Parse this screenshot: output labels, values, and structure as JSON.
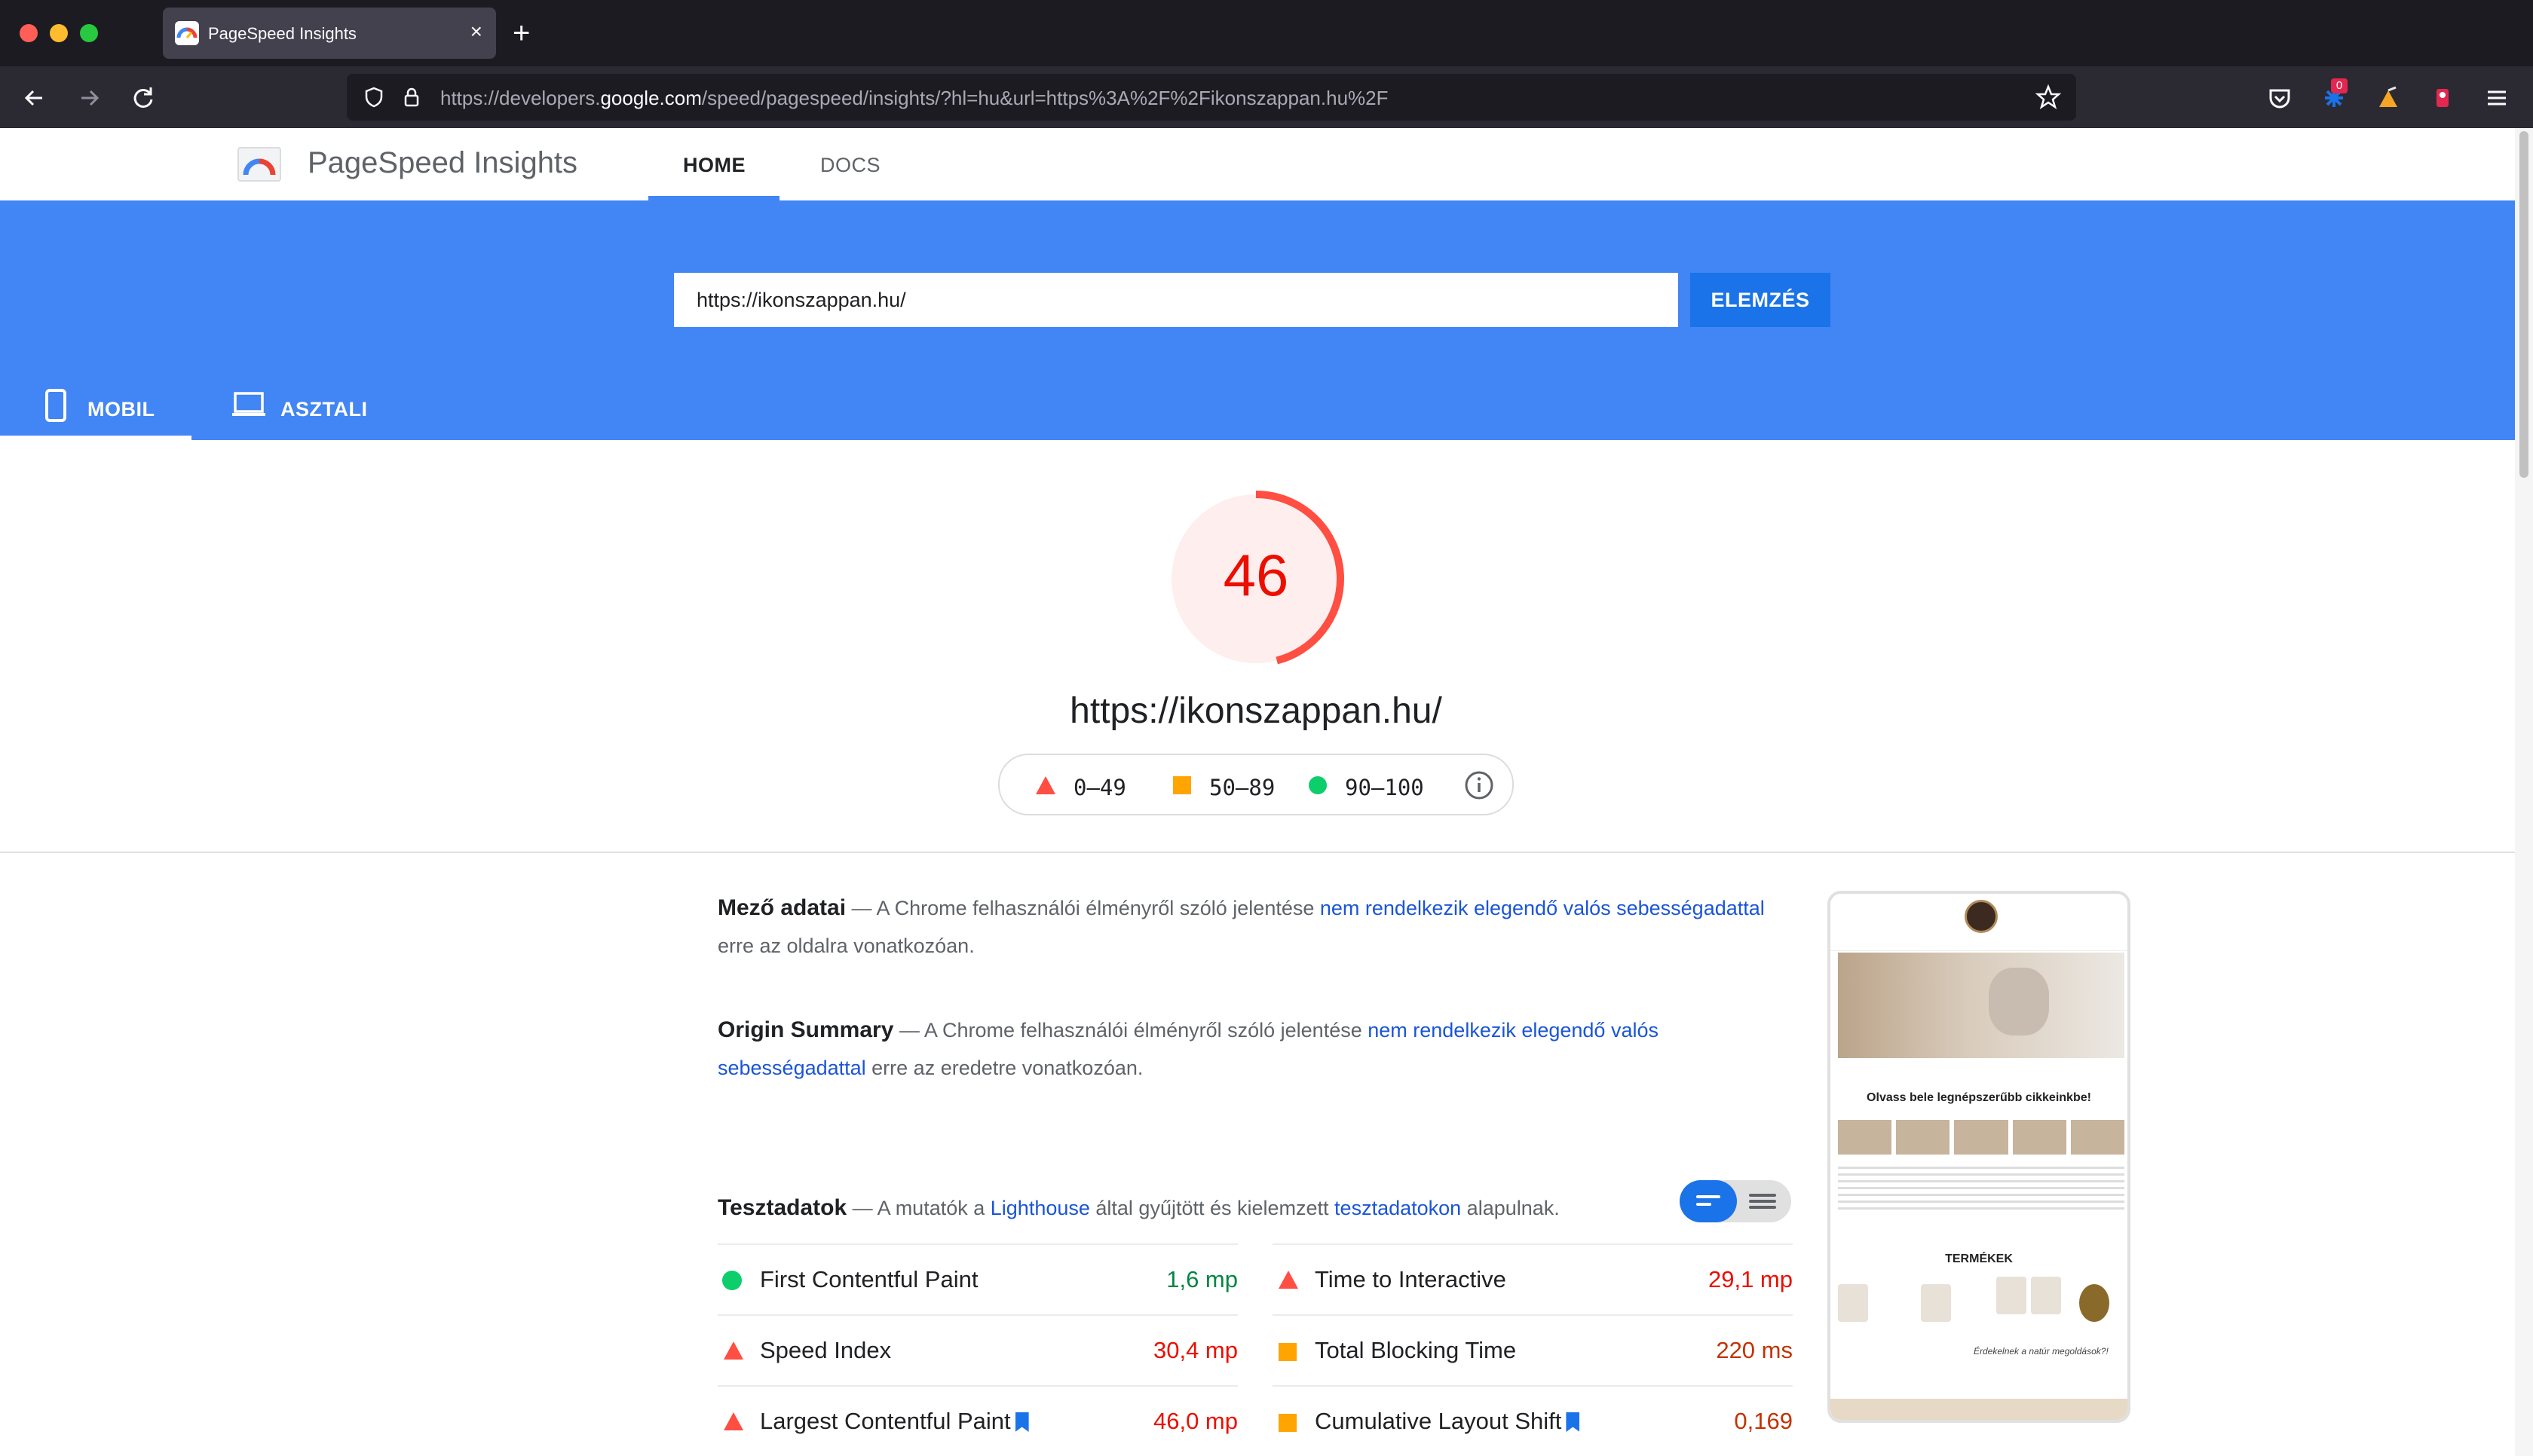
{
  "browser": {
    "tab_title": "PageSpeed Insights",
    "tab_close": "×",
    "new_tab": "+",
    "url_prefix": "https://developers.",
    "url_host": "google.com",
    "url_suffix": "/speed/pagespeed/insights/?hl=hu&url=https%3A%2F%2Fikonszappan.hu%2F",
    "extension_badge": "0",
    "icons": [
      "back-arrow-icon",
      "forward-arrow-icon",
      "reload-icon",
      "shield-icon",
      "lock-icon",
      "star-icon",
      "pocket-icon",
      "extension-icon",
      "profile-icon",
      "menu-icon"
    ]
  },
  "header": {
    "brand": "PageSpeed Insights",
    "nav_home": "HOME",
    "nav_docs": "DOCS"
  },
  "hero": {
    "url_value": "https://ikonszappan.hu/",
    "analyze_label": "ELEMZÉS",
    "tab_mobile": "MOBIL",
    "tab_desktop": "ASZTALI"
  },
  "score": {
    "value": 46,
    "display": "46",
    "url": "https://ikonszappan.hu/",
    "legend_poor": "0–49",
    "legend_avg": "50–89",
    "legend_good": "90–100",
    "color_poor": "#ff4e42",
    "color_avg": "#ffa400",
    "color_good": "#0cce6b"
  },
  "field": {
    "head": "Mező adatai",
    "text_a": " — A Chrome felhasználói élményről szóló jelentése ",
    "link": "nem rendelkezik elegendő valós sebességadattal",
    "text_b": " erre az oldalra vonatkozóan."
  },
  "origin": {
    "head": "Origin Summary",
    "text_a": " — A Chrome felhasználói élményről szóló jelentése ",
    "link": "nem rendelkezik elegendő valós sebességadattal",
    "text_b": " erre az eredetre vonatkozóan."
  },
  "lab": {
    "head": "Tesztadatok",
    "text_a": " — A mutatók a ",
    "link1": "Lighthouse",
    "text_b": " által gyűjtött és kielemzett ",
    "link2": "tesztadatokon",
    "text_c": " alapulnak."
  },
  "metrics_left": [
    {
      "name": "First Contentful Paint",
      "value": "1,6 mp",
      "rating": "good"
    },
    {
      "name": "Speed Index",
      "value": "30,4 mp",
      "rating": "poor"
    },
    {
      "name": "Largest Contentful Paint",
      "value": "46,0 mp",
      "rating": "poor"
    }
  ],
  "metrics_right": [
    {
      "name": "Time to Interactive",
      "value": "29,1 mp",
      "rating": "poor"
    },
    {
      "name": "Total Blocking Time",
      "value": "220 ms",
      "rating": "avg"
    },
    {
      "name": "Cumulative Layout Shift",
      "value": "0,169",
      "rating": "avg"
    }
  ],
  "preview": {
    "headline": "Olvass bele legnépszerűbb cikkeinkbe!",
    "products_title": "TERMÉKEK",
    "subtitle": "Érdekelnek a natúr megoldások?!"
  }
}
